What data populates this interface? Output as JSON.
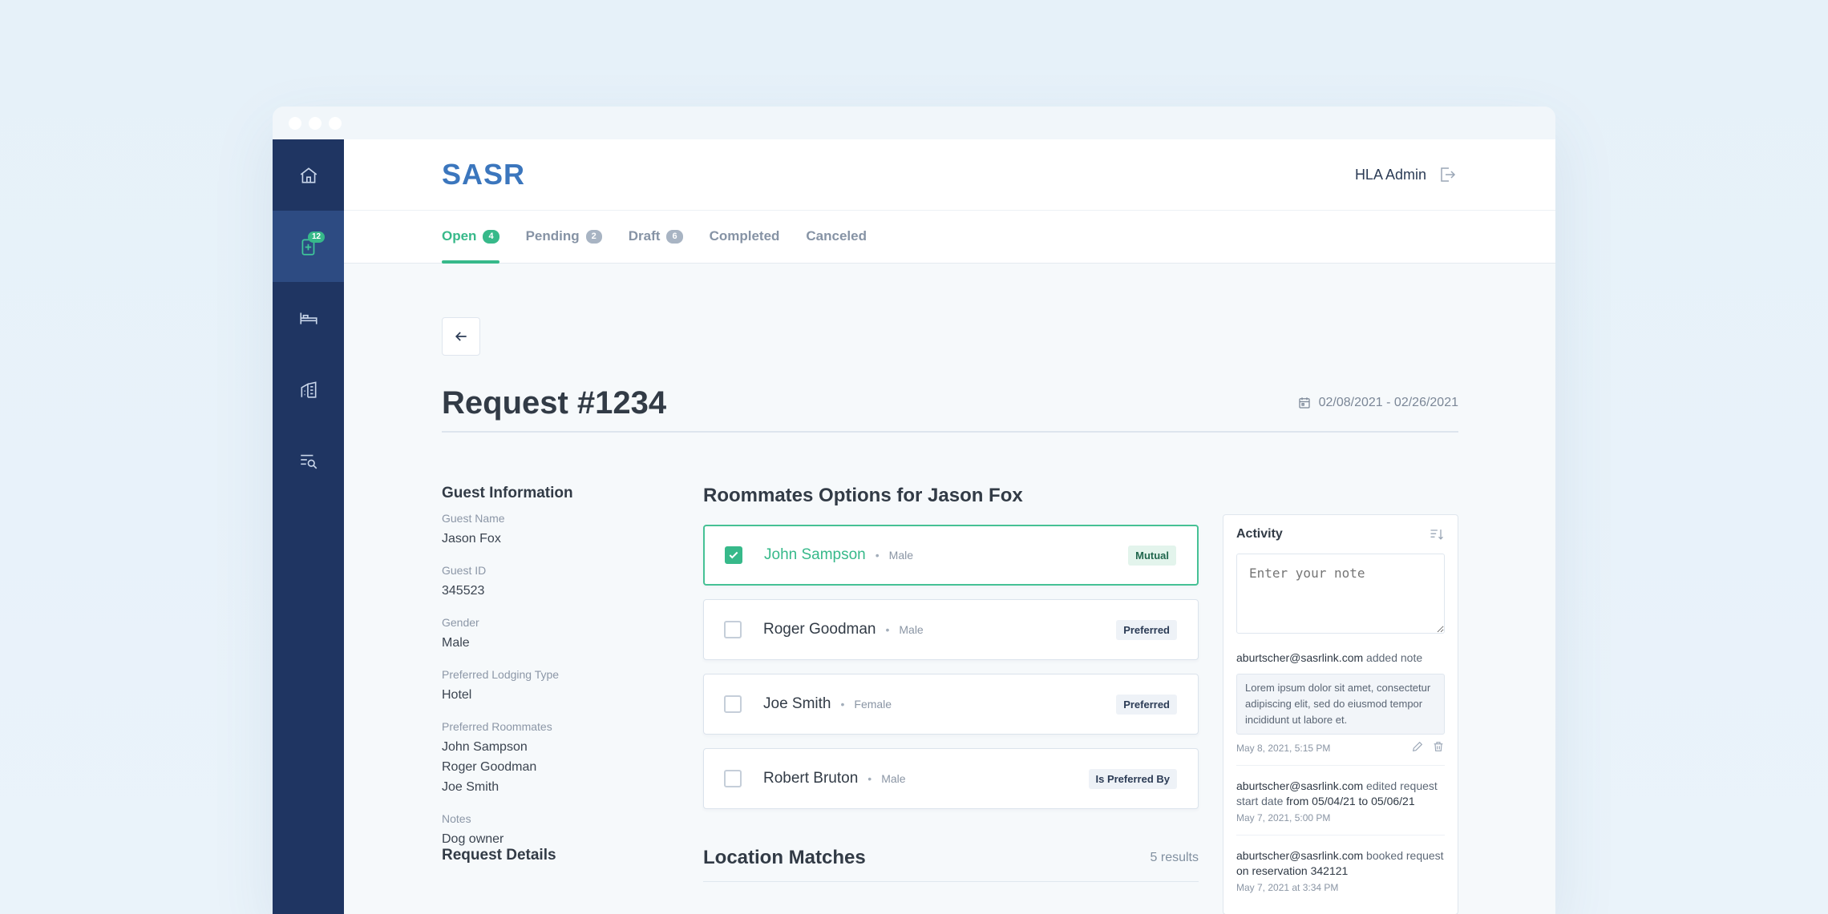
{
  "app": {
    "logo": "SASR",
    "user": "HLA Admin"
  },
  "sidebar": {
    "items": [
      {
        "name": "home",
        "icon": "home-icon"
      },
      {
        "name": "requests",
        "icon": "add-document-icon",
        "badge": "12",
        "active": true
      },
      {
        "name": "lodging",
        "icon": "bed-icon"
      },
      {
        "name": "buildings",
        "icon": "building-icon"
      },
      {
        "name": "search",
        "icon": "list-search-icon"
      }
    ]
  },
  "tabs": [
    {
      "label": "Open",
      "count": "4",
      "active": true
    },
    {
      "label": "Pending",
      "count": "2"
    },
    {
      "label": "Draft",
      "count": "6"
    },
    {
      "label": "Completed"
    },
    {
      "label": "Canceled"
    }
  ],
  "request": {
    "title": "Request #1234",
    "dates": "02/08/2021 - 02/26/2021"
  },
  "guest": {
    "heading": "Guest Information",
    "name_label": "Guest Name",
    "name": "Jason Fox",
    "id_label": "Guest ID",
    "id": "345523",
    "gender_label": "Gender",
    "gender": "Male",
    "lodging_label": "Preferred Lodging Type",
    "lodging": "Hotel",
    "roommates_label": "Preferred Roommates",
    "roommates": [
      "John Sampson",
      "Roger Goodman",
      "Joe Smith"
    ],
    "notes_label": "Notes",
    "notes": "Dog owner"
  },
  "request_details": {
    "heading": "Request Details"
  },
  "roommate_options": {
    "title": "Roommates Options for Jason Fox",
    "items": [
      {
        "name": "John Sampson",
        "sep": "•",
        "gender": "Male",
        "tag": "Mutual",
        "checked": true
      },
      {
        "name": "Roger Goodman",
        "sep": "•",
        "gender": "Male",
        "tag": "Preferred",
        "checked": false
      },
      {
        "name": "Joe Smith",
        "sep": "•",
        "gender": "Female",
        "tag": "Preferred",
        "checked": false
      },
      {
        "name": "Robert Bruton",
        "sep": "•",
        "gender": "Male",
        "tag": "Is Preferred By",
        "checked": false
      }
    ]
  },
  "location_matches": {
    "title": "Location Matches",
    "count": "5 results"
  },
  "activity": {
    "title": "Activity",
    "note_placeholder": "Enter your note",
    "entries": [
      {
        "user": "aburtscher@sasrlink.com",
        "action": " added note",
        "quote": "Lorem ipsum dolor sit amet, consectetur adipiscing elit, sed do eiusmod tempor incididunt ut labore et.",
        "time": "May 8, 2021, 5:15 PM"
      },
      {
        "user": "aburtscher@sasrlink.com",
        "action": " edited request start date ",
        "detail": "from 05/04/21 to 05/06/21",
        "time": "May 7, 2021, 5:00 PM"
      },
      {
        "user": "aburtscher@sasrlink.com",
        "action": " booked request ",
        "detail": "on reservation 342121",
        "time": "May 7, 2021 at 3:34 PM"
      }
    ]
  }
}
